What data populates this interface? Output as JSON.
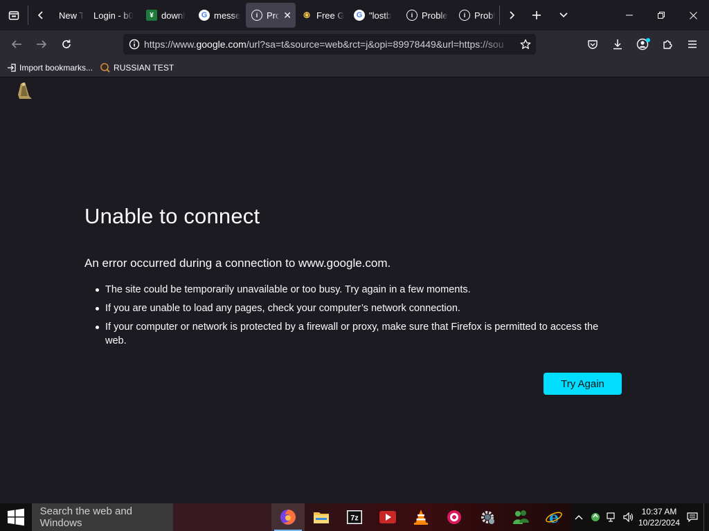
{
  "browser": {
    "tabs": [
      {
        "label": "New T",
        "favicon": "none"
      },
      {
        "label": "Login - b0",
        "favicon": "none"
      },
      {
        "label": "downl",
        "favicon": "green-arrow-icon"
      },
      {
        "label": "messe",
        "favicon": "google-icon"
      },
      {
        "label": "Pro",
        "favicon": "info-icon",
        "active": true
      },
      {
        "label": "Free G",
        "favicon": "game-icon"
      },
      {
        "label": "\"lostb",
        "favicon": "google-icon"
      },
      {
        "label": "Proble",
        "favicon": "info-icon"
      },
      {
        "label": "Proble",
        "favicon": "info-icon"
      }
    ],
    "url_prefix": "https://www.",
    "url_domain": "google.com",
    "url_rest": "/url?sa=t&source=web&rct=j&opi=89978449&url=https://sou",
    "bookmarks": [
      {
        "label": "Import bookmarks...",
        "icon": "import-icon"
      },
      {
        "label": "RUSSIAN TEST",
        "icon": "globe-icon"
      }
    ]
  },
  "error": {
    "title": "Unable to connect",
    "subtitle": "An error occurred during a connection to www.google.com.",
    "items": [
      "The site could be temporarily unavailable or too busy. Try again in a few moments.",
      "If you are unable to load any pages, check your computer’s network connection.",
      "If your computer or network is protected by a firewall or proxy, make sure that Firefox is permitted to access the web."
    ],
    "button": "Try Again"
  },
  "taskbar": {
    "search_placeholder": "Search the web and Windows",
    "apps": [
      "firefox-icon",
      "file-explorer-icon",
      "7zip-icon",
      "media-player-icon",
      "vlc-icon",
      "app-icon",
      "settings-icon",
      "messenger-icon",
      "internet-explorer-icon"
    ],
    "time": "10:37 AM",
    "date": "10/22/2024"
  },
  "colors": {
    "accent": "#00ddff",
    "page_bg": "#1c1b22",
    "toolbar_bg": "#2b2a33"
  }
}
